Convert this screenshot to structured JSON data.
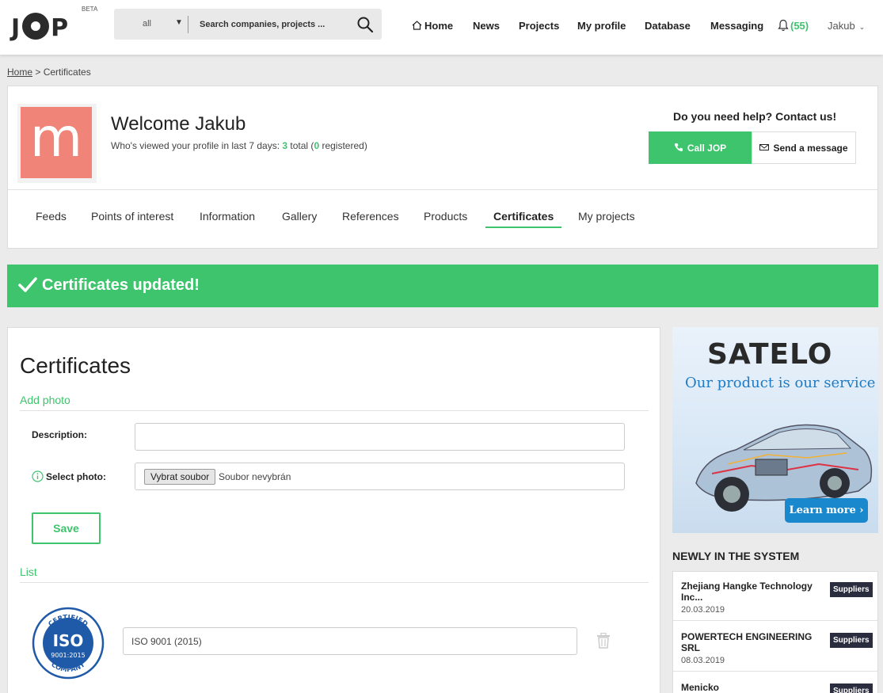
{
  "header": {
    "logo_text": "JOP",
    "logo_beta": "BETA",
    "search": {
      "scope": "all",
      "placeholder": "Search companies, projects ..."
    },
    "nav": [
      "Home",
      "News",
      "Projects",
      "My profile",
      "Database",
      "Messaging"
    ],
    "notifications_count": "(55)",
    "user_name": "Jakub"
  },
  "breadcrumb": {
    "home": "Home",
    "current": "> Certificates"
  },
  "profile": {
    "avatar_letter": "m",
    "welcome": "Welcome Jakub",
    "views_prefix": "Who's viewed your profile in last 7 days: ",
    "views_count": "3",
    "views_mid": " total (",
    "views_registered": "0",
    "views_suffix": " registered)",
    "help_title": "Do you need help? Contact us!",
    "call_label": "Call JOP",
    "message_label": "Send a message",
    "tabs": [
      "Feeds",
      "Points of interest",
      "Information",
      "Gallery",
      "References",
      "Products",
      "Certificates",
      "My projects"
    ],
    "active_tab": "Certificates"
  },
  "banner": {
    "text": "Certificates updated!"
  },
  "main": {
    "title": "Certificates",
    "add_photo": "Add photo",
    "description_label": "Description:",
    "description_value": "",
    "select_photo_label": "Select photo:",
    "file_button": "Vybrat soubor",
    "file_status": "Soubor nevybrán",
    "save_label": "Save",
    "list_label": "List",
    "certificates": [
      {
        "name": "ISO 9001 (2015)",
        "logo_top": "CERTIFIED",
        "logo_main": "ISO",
        "logo_sub": "9001:2015",
        "logo_bottom": "COMPANY"
      }
    ]
  },
  "sidebar": {
    "ad": {
      "brand": "SATELO",
      "slogan": "Our product is our service",
      "button": "Learn more"
    },
    "newly_title": "NEWLY IN THE SYSTEM",
    "newly": [
      {
        "name": "Zhejiang Hangke Technology Inc...",
        "date": "20.03.2019",
        "badge": "Suppliers"
      },
      {
        "name": "POWERTECH ENGINEERING SRL",
        "date": "08.03.2019",
        "badge": "Suppliers"
      },
      {
        "name": "Menicko",
        "date": "",
        "badge": "Suppliers"
      }
    ]
  },
  "colors": {
    "accent_green": "#3ec46d",
    "avatar": "#f08478",
    "badge_dark": "#2a2d3e",
    "ad_blue": "#1a88cc"
  }
}
